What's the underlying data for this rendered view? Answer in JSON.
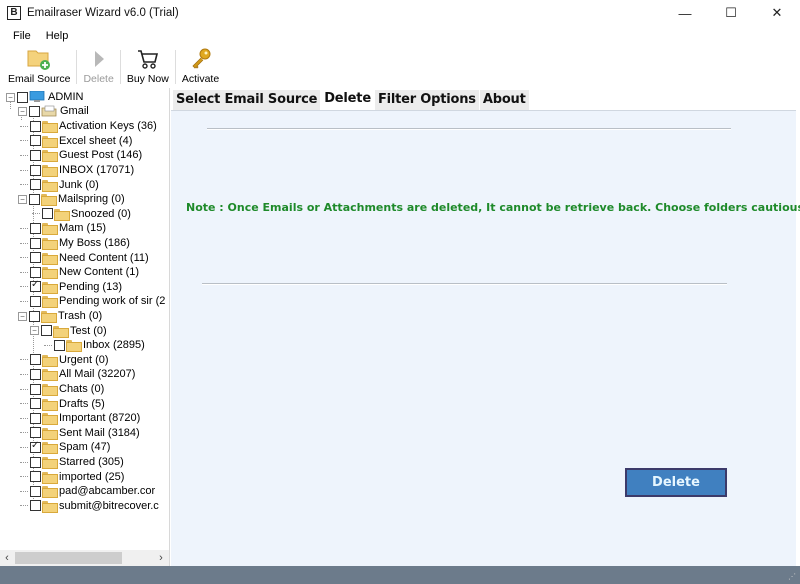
{
  "window": {
    "title": "Emailraser Wizard v6.0 (Trial)",
    "app_icon_letter": "B",
    "minimize": "—",
    "maximize": "☐",
    "close": "✕"
  },
  "menu": [
    {
      "label": "File"
    },
    {
      "label": "Help"
    }
  ],
  "toolbar": {
    "email_source": "Email Source",
    "delete": "Delete",
    "buy_now": "Buy Now",
    "activate": "Activate"
  },
  "tree": {
    "root": {
      "label": "ADMIN",
      "expander": "−"
    },
    "account": {
      "label": "Gmail",
      "expander": "−"
    },
    "items": [
      {
        "label": "Activation Keys (36)",
        "checked": false,
        "level": 2
      },
      {
        "label": "Excel sheet (4)",
        "checked": false,
        "level": 2
      },
      {
        "label": "Guest Post (146)",
        "checked": false,
        "level": 2
      },
      {
        "label": "INBOX (17071)",
        "checked": false,
        "level": 2
      },
      {
        "label": "Junk (0)",
        "checked": false,
        "level": 2
      },
      {
        "label": "Mailspring (0)",
        "checked": false,
        "level": 2,
        "expander": "−"
      },
      {
        "label": "Snoozed (0)",
        "checked": false,
        "level": 3
      },
      {
        "label": "Mam (15)",
        "checked": false,
        "level": 2
      },
      {
        "label": "My Boss (186)",
        "checked": false,
        "level": 2
      },
      {
        "label": "Need Content (11)",
        "checked": false,
        "level": 2
      },
      {
        "label": "New Content (1)",
        "checked": false,
        "level": 2
      },
      {
        "label": "Pending (13)",
        "checked": true,
        "level": 2
      },
      {
        "label": "Pending work of sir (2",
        "checked": false,
        "level": 2
      },
      {
        "label": "Trash (0)",
        "checked": false,
        "level": 2,
        "expander": "−"
      },
      {
        "label": "Test (0)",
        "checked": false,
        "level": 3,
        "expander": "−"
      },
      {
        "label": "Inbox (2895)",
        "checked": false,
        "level": 4
      },
      {
        "label": "Urgent (0)",
        "checked": false,
        "level": 2
      },
      {
        "label": "All Mail (32207)",
        "checked": false,
        "level": 2
      },
      {
        "label": "Chats (0)",
        "checked": false,
        "level": 2
      },
      {
        "label": "Drafts (5)",
        "checked": false,
        "level": 2
      },
      {
        "label": "Important (8720)",
        "checked": false,
        "level": 2
      },
      {
        "label": "Sent Mail (3184)",
        "checked": false,
        "level": 2
      },
      {
        "label": "Spam (47)",
        "checked": true,
        "level": 2
      },
      {
        "label": "Starred (305)",
        "checked": false,
        "level": 2
      },
      {
        "label": "imported (25)",
        "checked": false,
        "level": 2
      },
      {
        "label": "pad@abcamber.cor",
        "checked": false,
        "level": 2
      },
      {
        "label": "submit@bitrecover.c",
        "checked": false,
        "level": 2
      }
    ],
    "scroll_left": "‹",
    "scroll_right": "›"
  },
  "tabs": [
    {
      "label": "Select Email Source",
      "active": false
    },
    {
      "label": "Delete",
      "active": true
    },
    {
      "label": "Filter Options",
      "active": false
    },
    {
      "label": "About",
      "active": false
    }
  ],
  "delete_panel": {
    "note": "Note : Once Emails or Attachments are deleted, It cannot be retrieve back. Choose folders cautiously.",
    "delete_button": "Delete"
  },
  "colors": {
    "note_green": "#1e8a2a",
    "delete_button_bg": "#4080c0",
    "panel_bg": "#eef4fc",
    "statusbar": "#6c7b8b"
  }
}
